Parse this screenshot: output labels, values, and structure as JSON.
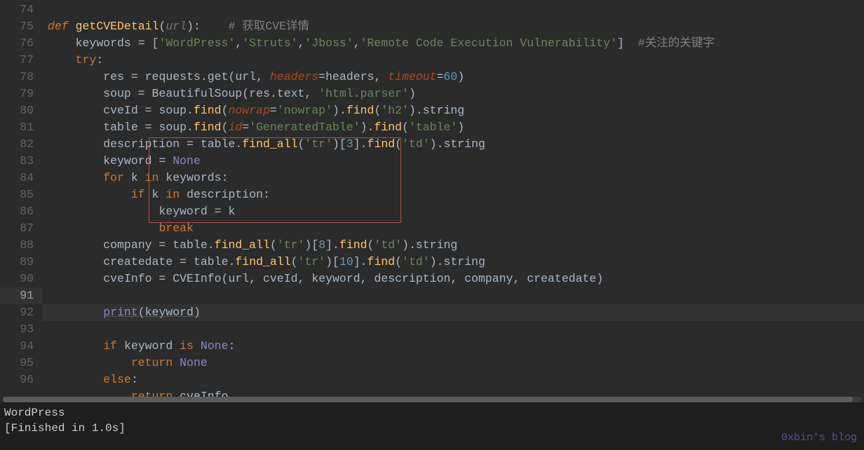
{
  "lines": [
    {
      "n": 74
    },
    {
      "n": 75
    },
    {
      "n": 76
    },
    {
      "n": 77
    },
    {
      "n": 78
    },
    {
      "n": 79
    },
    {
      "n": 80
    },
    {
      "n": 81
    },
    {
      "n": 82
    },
    {
      "n": 83
    },
    {
      "n": 84
    },
    {
      "n": 85
    },
    {
      "n": 86
    },
    {
      "n": 87
    },
    {
      "n": 88
    },
    {
      "n": 89
    },
    {
      "n": 90
    },
    {
      "n": 91,
      "hl": true
    },
    {
      "n": 92
    },
    {
      "n": 93
    },
    {
      "n": 94
    },
    {
      "n": 95
    },
    {
      "n": 96
    }
  ],
  "t": {
    "def": "def",
    "fn_name": "getCVEDetail",
    "url": "url",
    "comment1": "# 获取CVE详情",
    "keywords": "keywords",
    "eq": " = ",
    "lb": "[",
    "rb": "]",
    "s_wp": "'WordPress'",
    "s_struts": "'Struts'",
    "s_jboss": "'Jboss'",
    "s_rce": "'Remote Code Execution Vulnerability'",
    "comma": ",",
    "comment2": "#关注的关键字",
    "try": "try",
    "colon": ":",
    "res": "res",
    "requests": "requests",
    "get": "get",
    "lp": "(",
    "rp": ")",
    "headers_kw": "headers",
    "headers_val": "headers",
    "timeout_kw": "timeout",
    "n60": "60",
    "soup": "soup",
    "BeautifulSoup": "BeautifulSoup",
    "text": "text",
    "s_htmlparser": "'html.parser'",
    "cveId": "cveId",
    "find": "find",
    "nowrap_kw": "nowrap",
    "s_nowrap": "'nowrap'",
    "s_h2": "'h2'",
    "string": "string",
    "table": "table",
    "id_kw": "id",
    "s_gentable": "'GeneratedTable'",
    "s_table": "'table'",
    "description": "description",
    "find_all": "find_all",
    "s_tr": "'tr'",
    "s_td": "'td'",
    "n3": "3",
    "n8": "8",
    "n10": "10",
    "keyword": "keyword",
    "None": "None",
    "for": "for",
    "k": "k",
    "in": "in",
    "if": "if",
    "break": "break",
    "company": "company",
    "createdate": "createdate",
    "cveInfo": "cveInfo",
    "CVEInfo": "CVEInfo",
    "print": "print",
    "is": "is",
    "return": "return",
    "else": "else",
    "dot": "."
  },
  "console": {
    "out1": "WordPress",
    "out2": "[Finished in 1.0s]"
  },
  "watermark": "0xbin's blog"
}
